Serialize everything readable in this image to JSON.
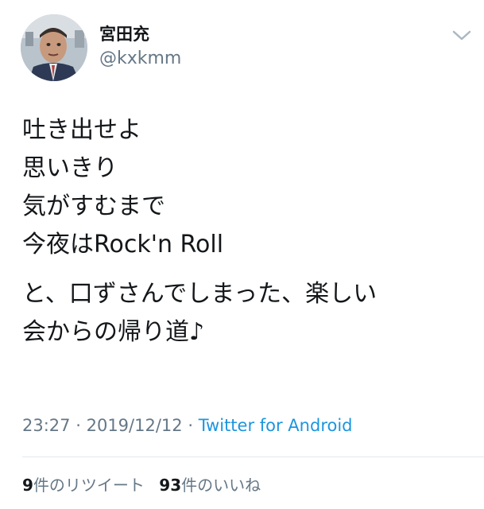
{
  "author": {
    "display_name": "宮田充",
    "handle": "@kxkmm"
  },
  "tweet": {
    "lines": [
      "吐き出せよ",
      "思いきり",
      "気がすむまで",
      "今夜はRock'n Roll",
      "と、口ずさんでしまった、楽しい",
      "会からの帰り道♪"
    ]
  },
  "meta": {
    "time": "23:27",
    "separator": "·",
    "date": "2019/12/12",
    "source": "Twitter for Android"
  },
  "stats": {
    "retweets_count": "9",
    "retweets_label": "件のリツイート",
    "likes_count": "93",
    "likes_label": "件のいいね"
  },
  "icons": {
    "more": "chevron-down-icon",
    "avatar": "avatar"
  },
  "colors": {
    "text": "#14171a",
    "secondary": "#657786",
    "link": "#1b95e0",
    "divider": "#e1e8ed"
  }
}
